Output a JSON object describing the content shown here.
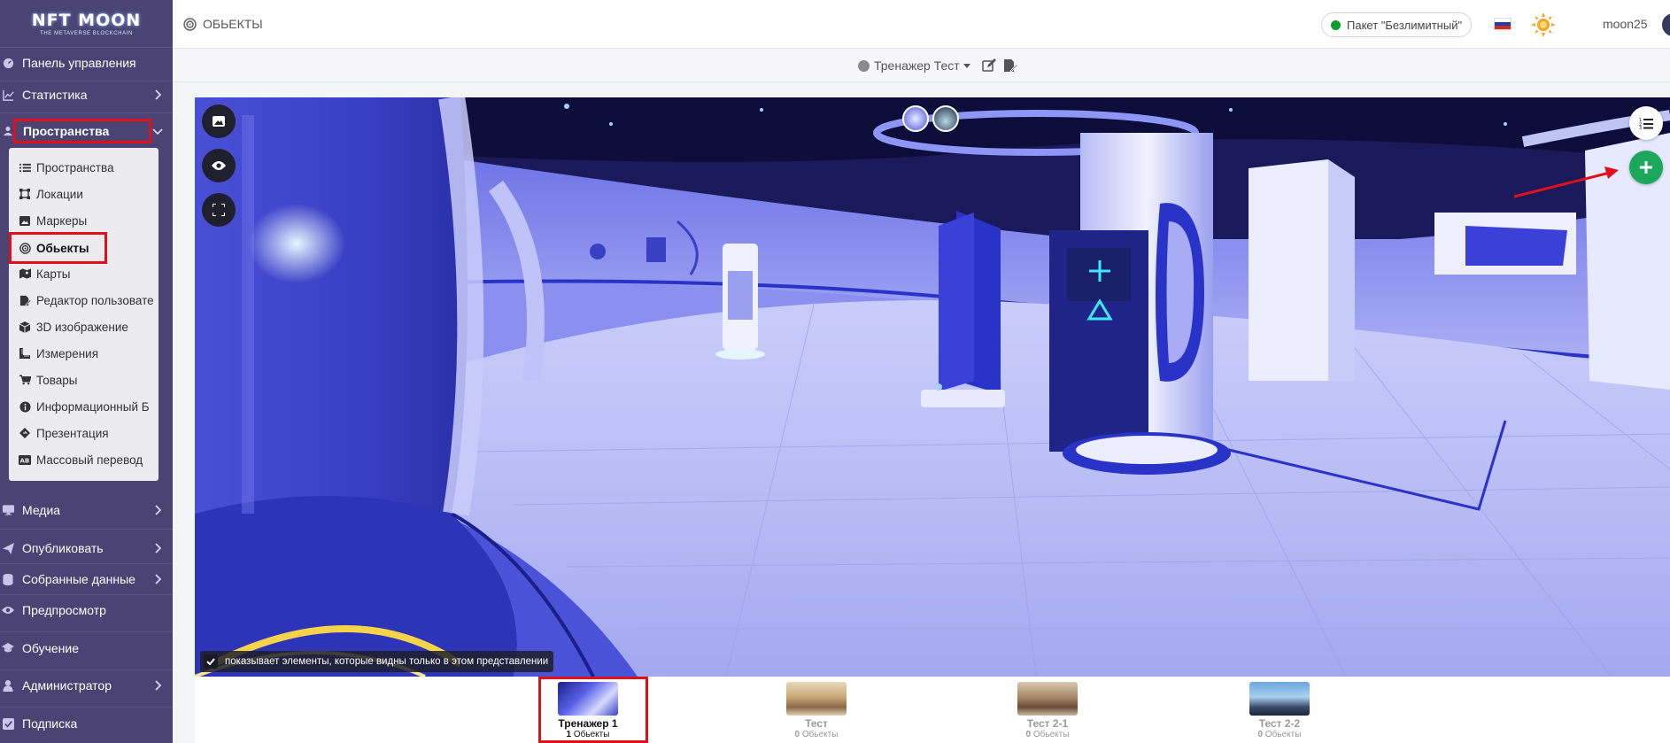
{
  "brand": {
    "name": "NFT MOON",
    "tagline": "THE METAVERSE BLOCKCHAIN"
  },
  "sidebar": {
    "items": [
      {
        "label": "Панель управления",
        "icon": "dashboard-icon",
        "chevron": false
      },
      {
        "label": "Статистика",
        "icon": "chart-icon",
        "chevron": true
      },
      {
        "label": "Пространства",
        "icon": "users-icon",
        "chevron": true,
        "expanded": true
      },
      {
        "label": "Медиа",
        "icon": "desktop-icon",
        "chevron": true
      },
      {
        "label": "Опубликовать",
        "icon": "paper-plane-icon",
        "chevron": true
      },
      {
        "label": "Собранные данные",
        "icon": "database-icon",
        "chevron": true
      },
      {
        "label": "Предпросмотр",
        "icon": "eye-icon",
        "chevron": false
      },
      {
        "label": "Обучение",
        "icon": "graduation-icon",
        "chevron": false
      },
      {
        "label": "Администратор",
        "icon": "user-icon",
        "chevron": true
      },
      {
        "label": "Подписка",
        "icon": "subscription-icon",
        "chevron": false
      }
    ],
    "submenu": [
      {
        "label": "Пространства",
        "icon": "list-icon"
      },
      {
        "label": "Локации",
        "icon": "vector-square-icon"
      },
      {
        "label": "Маркеры",
        "icon": "image-icon"
      },
      {
        "label": "Обьекты",
        "icon": "bullseye-icon",
        "active": true
      },
      {
        "label": "Карты",
        "icon": "map-icon"
      },
      {
        "label": "Редактор пользовате",
        "icon": "edit-layers-icon"
      },
      {
        "label": "3D изображение",
        "icon": "cube-icon"
      },
      {
        "label": "Измерения",
        "icon": "ruler-icon"
      },
      {
        "label": "Товары",
        "icon": "cart-icon"
      },
      {
        "label": "Информационный Б",
        "icon": "info-circle-icon"
      },
      {
        "label": "Презентация",
        "icon": "diamond-icon"
      },
      {
        "label": "Массовый перевод",
        "icon": "id-card-icon"
      }
    ]
  },
  "topbar": {
    "page_title": "ОБЬЕКТЫ",
    "package_label": "Пакет \"Безлимитный\"",
    "language_flag": "ru",
    "username": "moon25"
  },
  "subbar": {
    "space_name": "Тренажер Тест"
  },
  "viewer": {
    "objects_count": "1",
    "hint_text": "показывает элементы, которые видны только в этом представлении",
    "hint_checked": true
  },
  "views": [
    {
      "name": "Тренажер 1",
      "count": "1",
      "count_label": "Обьекты",
      "active": true
    },
    {
      "name": "Тест",
      "count": "0",
      "count_label": "Обьекты",
      "active": false
    },
    {
      "name": "Тест 2-1",
      "count": "0",
      "count_label": "Обьекты",
      "active": false
    },
    {
      "name": "Тест 2-2",
      "count": "0",
      "count_label": "Обьекты",
      "active": false
    }
  ],
  "colors": {
    "sidebar_bg": "#4a4373",
    "submenu_bg": "#ebebf0",
    "highlight_red": "#e0101a",
    "add_button_green": "#1aa85b",
    "status_green": "#0c9b2d"
  }
}
